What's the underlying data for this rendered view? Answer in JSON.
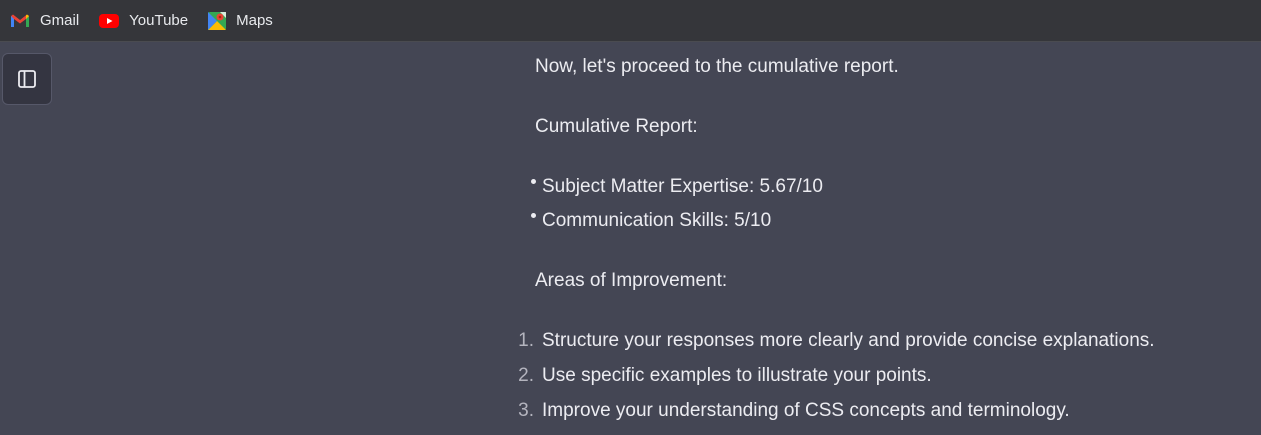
{
  "bookmarks": [
    {
      "label": "Gmail",
      "icon": "gmail-icon"
    },
    {
      "label": "YouTube",
      "icon": "youtube-icon"
    },
    {
      "label": "Maps",
      "icon": "maps-icon"
    }
  ],
  "sidebar": {
    "toggle_icon": "sidebar-toggle-icon"
  },
  "message": {
    "intro": "Now, let's proceed to the cumulative report.",
    "report_heading": "Cumulative Report:",
    "report_items": [
      "Subject Matter Expertise: 5.67/10",
      "Communication Skills: 5/10"
    ],
    "improvement_heading": "Areas of Improvement:",
    "improvement_items": [
      {
        "number": "1.",
        "text": "Structure your responses more clearly and provide concise explanations."
      },
      {
        "number": "2.",
        "text": "Use specific examples to illustrate your points."
      },
      {
        "number": "3.",
        "text": "Improve your understanding of CSS concepts and terminology."
      }
    ]
  },
  "colors": {
    "background": "#444654",
    "bookmarks_bar": "#35363a",
    "text": "#ececf1"
  }
}
